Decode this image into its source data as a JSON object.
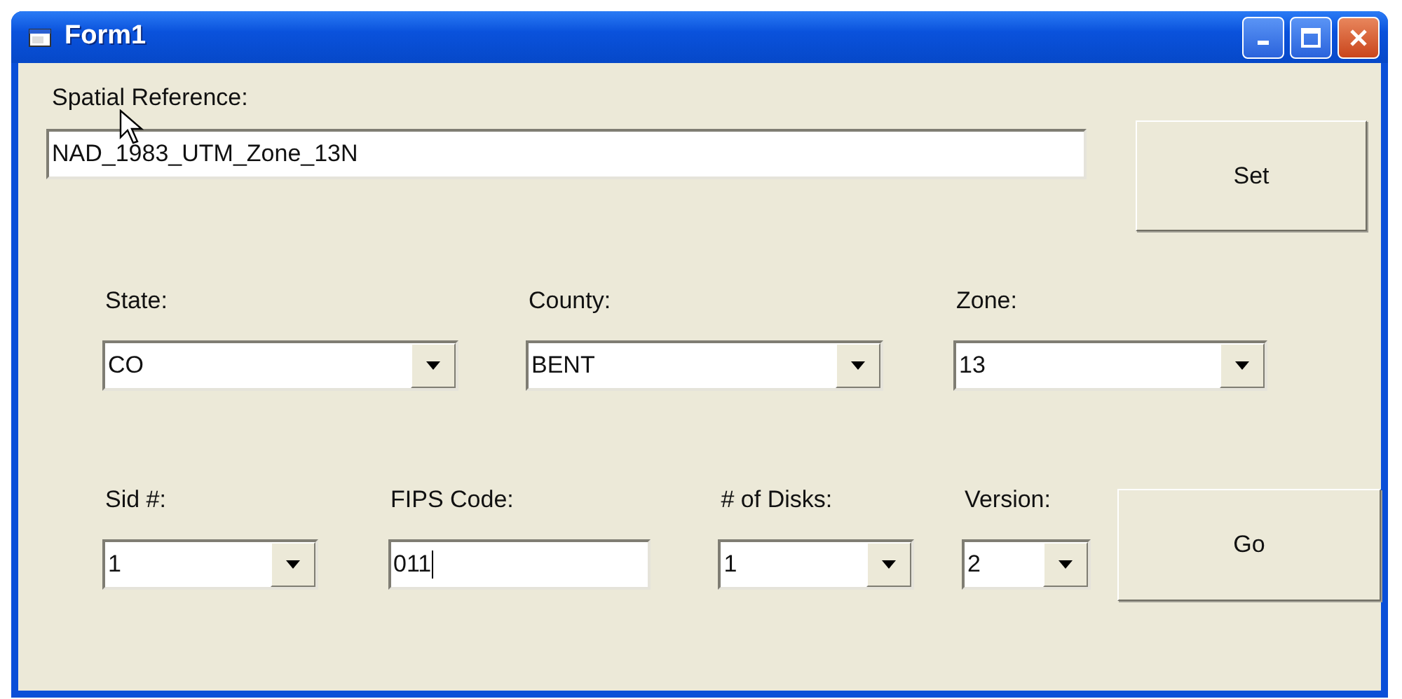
{
  "window": {
    "title": "Form1"
  },
  "spatial_reference": {
    "label": "Spatial Reference:",
    "value": "NAD_1983_UTM_Zone_13N"
  },
  "set_button": {
    "label": "Set"
  },
  "row_1": [
    {
      "kind": "combo",
      "label": "State:",
      "value": "CO"
    },
    {
      "kind": "combo",
      "label": "County:",
      "value": "BENT"
    },
    {
      "kind": "combo",
      "label": "Zone:",
      "value": "13"
    }
  ],
  "row_2": [
    {
      "kind": "combo",
      "label": "Sid #:",
      "value": "1"
    },
    {
      "kind": "text",
      "label": "FIPS Code:",
      "value": "011",
      "focused": true
    },
    {
      "kind": "combo",
      "label": "# of Disks:",
      "value": "1"
    },
    {
      "kind": "combo",
      "label": "Version:",
      "value": "2"
    }
  ],
  "go_button": {
    "label": "Go"
  }
}
